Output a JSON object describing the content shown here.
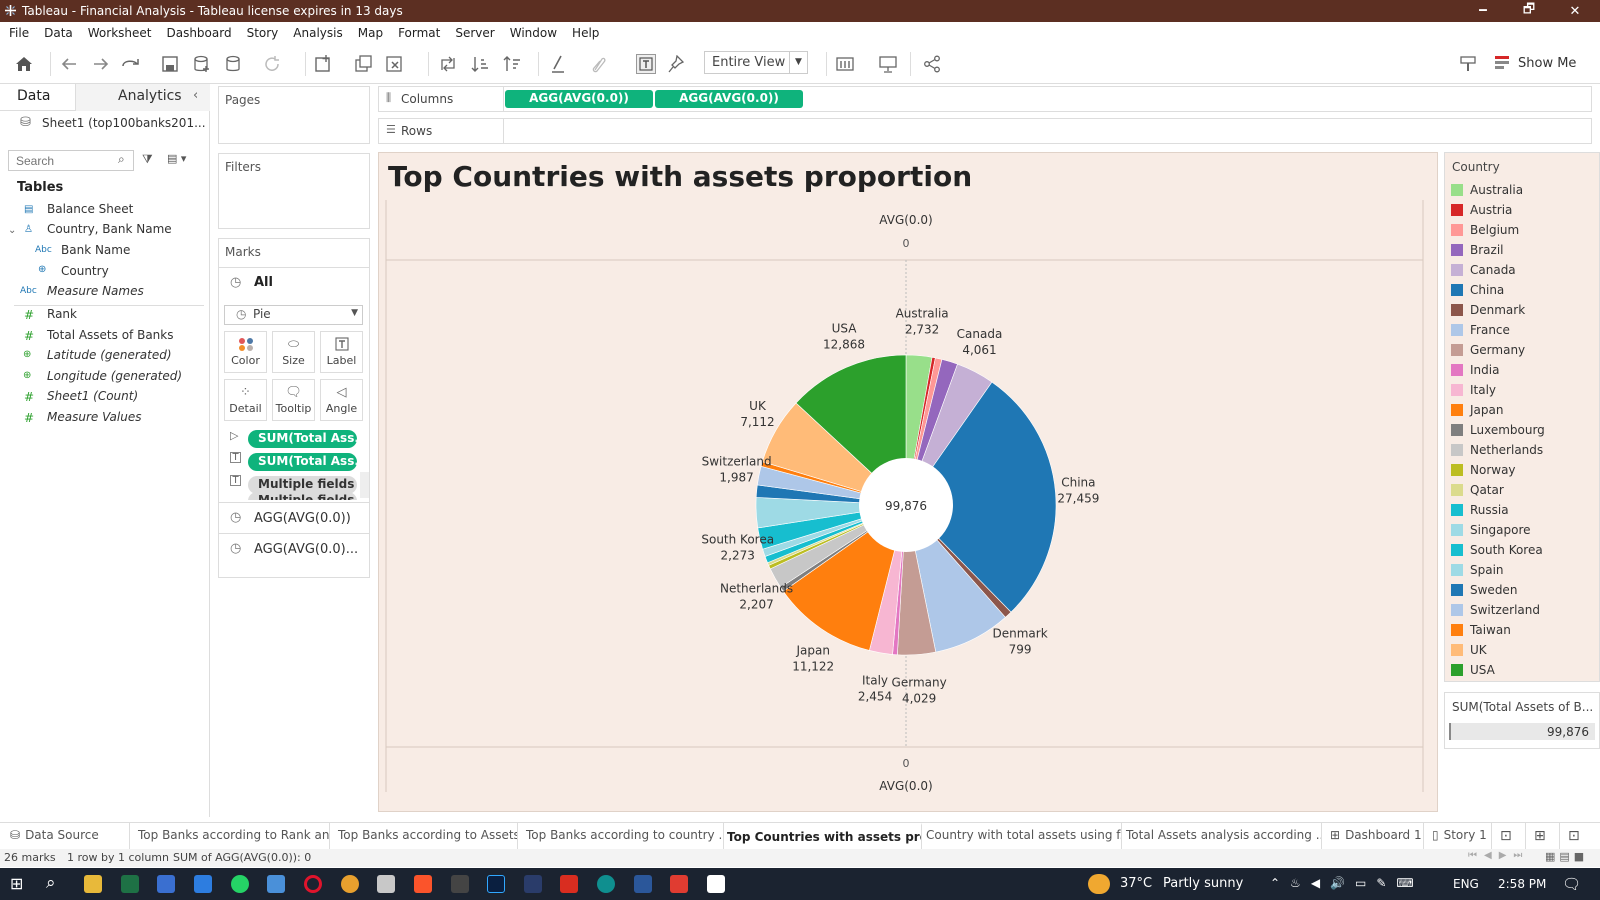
{
  "window": {
    "title": "Tableau - Financial Analysis - Tableau license expires in 13 days",
    "minimize": "🗕",
    "maximize": "🗗",
    "close": "✕"
  },
  "menu": [
    "File",
    "Data",
    "Worksheet",
    "Dashboard",
    "Story",
    "Analysis",
    "Map",
    "Format",
    "Server",
    "Window",
    "Help"
  ],
  "toolbar": {
    "view_mode": "Entire View",
    "show_me": "Show Me"
  },
  "left_pane": {
    "tab_data": "Data",
    "tab_analytics": "Analytics",
    "datasource": "Sheet1 (top100banks201...",
    "search_placeholder": "Search",
    "tables_heading": "Tables",
    "fields": [
      {
        "name": "Balance Sheet",
        "type": "table"
      },
      {
        "name": "Country, Bank Name",
        "type": "hierarchy"
      },
      {
        "name": "Bank Name",
        "type": "Abc"
      },
      {
        "name": "Country",
        "type": "geo"
      },
      {
        "name": "Measure Names",
        "type": "Abc"
      },
      {
        "name": "Rank",
        "type": "#"
      },
      {
        "name": "Total Assets of Banks",
        "type": "#"
      },
      {
        "name": "Latitude (generated)",
        "type": "geo"
      },
      {
        "name": "Longitude (generated)",
        "type": "geo"
      },
      {
        "name": "Sheet1 (Count)",
        "type": "#"
      },
      {
        "name": "Measure Values",
        "type": "#"
      }
    ]
  },
  "cards": {
    "pages": "Pages",
    "filters": "Filters",
    "marks": "Marks",
    "marks_all": "All",
    "mark_type": "Pie",
    "mark_buttons": [
      "Color",
      "Size",
      "Label",
      "Detail",
      "Tooltip",
      "Angle"
    ],
    "mark_pills": [
      "SUM(Total Ass..",
      "SUM(Total Ass..",
      "Multiple fields",
      "Multiple fields"
    ],
    "agg1": "AGG(AVG(0.0))",
    "agg2": "AGG(AVG(0.0)..."
  },
  "shelves": {
    "columns_label": "Columns",
    "rows_label": "Rows",
    "column_pills": [
      "AGG(AVG(0.0))",
      "AGG(AVG(0.0))"
    ]
  },
  "view": {
    "title": "Top Countries with assets proportion",
    "axis_top_title": "AVG(0.0)",
    "axis_top_tick": "0",
    "axis_bottom_tick": "0",
    "axis_bottom_title": "AVG(0.0)",
    "center_total": "99,876"
  },
  "chart_data": {
    "type": "pie",
    "title": "Top Countries with assets proportion",
    "total": 99876,
    "slices": [
      {
        "label": "Australia",
        "value": 2732,
        "color": "#98df8a"
      },
      {
        "label": "Austria",
        "value": 350,
        "color": "#d62728"
      },
      {
        "label": "Belgium",
        "value": 700,
        "color": "#ff9896"
      },
      {
        "label": "Brazil",
        "value": 1700,
        "color": "#9467bd"
      },
      {
        "label": "Canada",
        "value": 4061,
        "color": "#c5b0d5"
      },
      {
        "label": "China",
        "value": 27459,
        "color": "#1f77b4"
      },
      {
        "label": "Denmark",
        "value": 799,
        "color": "#8c564b"
      },
      {
        "label": "France",
        "value": 8200,
        "color": "#aec7e8"
      },
      {
        "label": "Germany",
        "value": 4029,
        "color": "#c49c94"
      },
      {
        "label": "India",
        "value": 500,
        "color": "#e377c2"
      },
      {
        "label": "Italy",
        "value": 2454,
        "color": "#f7b6d2"
      },
      {
        "label": "Japan",
        "value": 11122,
        "color": "#ff7f0e"
      },
      {
        "label": "Luxembourg",
        "value": 500,
        "color": "#7f7f7f"
      },
      {
        "label": "Netherlands",
        "value": 2207,
        "color": "#c7c7c7"
      },
      {
        "label": "Norway",
        "value": 400,
        "color": "#bcbd22"
      },
      {
        "label": "Qatar",
        "value": 300,
        "color": "#dbdb8d"
      },
      {
        "label": "Russia",
        "value": 700,
        "color": "#17becf"
      },
      {
        "label": "Singapore",
        "value": 800,
        "color": "#9edae5"
      },
      {
        "label": "South Korea",
        "value": 2273,
        "color": "#17becf"
      },
      {
        "label": "Spain",
        "value": 3200,
        "color": "#9edae5"
      },
      {
        "label": "Sweden",
        "value": 1300,
        "color": "#1f77b4"
      },
      {
        "label": "Switzerland",
        "value": 1987,
        "color": "#aec7e8"
      },
      {
        "label": "Taiwan",
        "value": 500,
        "color": "#ff7f0e"
      },
      {
        "label": "UK",
        "value": 7112,
        "color": "#ffbb78"
      },
      {
        "label": "USA",
        "value": 12868,
        "color": "#2ca02c"
      }
    ],
    "labeled": [
      {
        "label": "Australia",
        "value": "2,732"
      },
      {
        "label": "Canada",
        "value": "4,061"
      },
      {
        "label": "China",
        "value": "27,459"
      },
      {
        "label": "Denmark",
        "value": "799"
      },
      {
        "label": "Germany",
        "value": "4,029"
      },
      {
        "label": "Italy",
        "value": "2,454"
      },
      {
        "label": "Japan",
        "value": "11,122"
      },
      {
        "label": "Netherlands",
        "value": "2,207"
      },
      {
        "label": "South Korea",
        "value": "2,273"
      },
      {
        "label": "Switzerland",
        "value": "1,987"
      },
      {
        "label": "UK",
        "value": "7,112"
      },
      {
        "label": "USA",
        "value": "12,868"
      }
    ]
  },
  "legend": {
    "title": "Country",
    "items": [
      {
        "name": "Australia",
        "color": "#98df8a"
      },
      {
        "name": "Austria",
        "color": "#d62728"
      },
      {
        "name": "Belgium",
        "color": "#ff9896"
      },
      {
        "name": "Brazil",
        "color": "#9467bd"
      },
      {
        "name": "Canada",
        "color": "#c5b0d5"
      },
      {
        "name": "China",
        "color": "#1f77b4"
      },
      {
        "name": "Denmark",
        "color": "#8c564b"
      },
      {
        "name": "France",
        "color": "#aec7e8"
      },
      {
        "name": "Germany",
        "color": "#c49c94"
      },
      {
        "name": "India",
        "color": "#e377c2"
      },
      {
        "name": "Italy",
        "color": "#f7b6d2"
      },
      {
        "name": "Japan",
        "color": "#ff7f0e"
      },
      {
        "name": "Luxembourg",
        "color": "#7f7f7f"
      },
      {
        "name": "Netherlands",
        "color": "#c7c7c7"
      },
      {
        "name": "Norway",
        "color": "#bcbd22"
      },
      {
        "name": "Qatar",
        "color": "#dbdb8d"
      },
      {
        "name": "Russia",
        "color": "#17becf"
      },
      {
        "name": "Singapore",
        "color": "#9edae5"
      },
      {
        "name": "South Korea",
        "color": "#17becf"
      },
      {
        "name": "Spain",
        "color": "#9edae5"
      },
      {
        "name": "Sweden",
        "color": "#1f77b4"
      },
      {
        "name": "Switzerland",
        "color": "#aec7e8"
      },
      {
        "name": "Taiwan",
        "color": "#ff7f0e"
      },
      {
        "name": "UK",
        "color": "#ffbb78"
      },
      {
        "name": "USA",
        "color": "#2ca02c"
      }
    ],
    "size_title": "SUM(Total Assets of B...",
    "size_value": "99,876"
  },
  "bottom_tabs": [
    {
      "label": "Data Source",
      "active": false
    },
    {
      "label": "Top Banks according to Rank an...",
      "active": false
    },
    {
      "label": "Top Banks according to Assets",
      "active": false
    },
    {
      "label": "Top Banks according to country ...",
      "active": false
    },
    {
      "label": "Top Countries with assets pro...",
      "active": true
    },
    {
      "label": "Country with total assets using f...",
      "active": false
    },
    {
      "label": "Total Assets analysis according ...",
      "active": false
    },
    {
      "label": "Dashboard 1",
      "active": false
    },
    {
      "label": "Story 1",
      "active": false
    }
  ],
  "status": {
    "marks": "26 marks",
    "rows": "1 row by 1 column",
    "sum": "SUM of AGG(AVG(0.0)): 0"
  },
  "taskbar": {
    "weather_temp": "37°C",
    "weather_desc": "Partly sunny",
    "lang": "ENG",
    "time": "2:58 PM"
  }
}
